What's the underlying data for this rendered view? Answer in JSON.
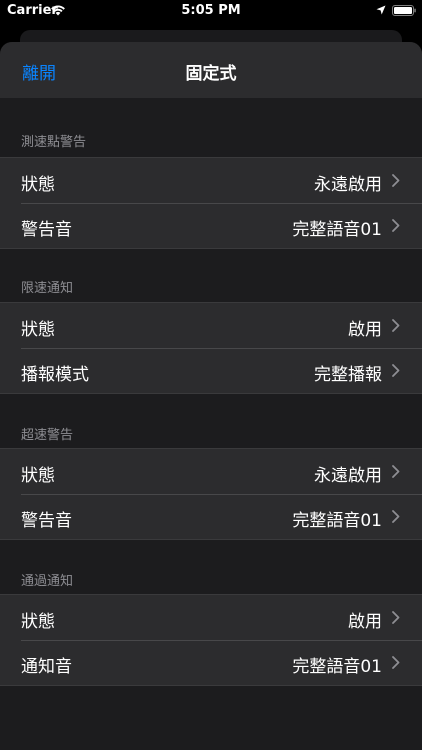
{
  "status_bar": {
    "carrier": "Carrier",
    "time": "5:05 PM",
    "wifi_icon": "wifi-icon",
    "location_icon": "location-arrow-icon",
    "battery_icon": "battery-full-icon"
  },
  "nav": {
    "close_label": "離開",
    "title": "固定式"
  },
  "colors": {
    "accent": "#0a84ff",
    "background": "#1c1c1e",
    "cell": "#2c2c2e",
    "secondary_text": "#8e8e93"
  },
  "sections": [
    {
      "header": "測速點警告",
      "rows": [
        {
          "label": "狀態",
          "value": "永遠啟用"
        },
        {
          "label": "警告音",
          "value": "完整語音01"
        }
      ]
    },
    {
      "header": "限速通知",
      "rows": [
        {
          "label": "狀態",
          "value": "啟用"
        },
        {
          "label": "播報模式",
          "value": "完整播報"
        }
      ]
    },
    {
      "header": "超速警告",
      "rows": [
        {
          "label": "狀態",
          "value": "永遠啟用"
        },
        {
          "label": "警告音",
          "value": "完整語音01"
        }
      ]
    },
    {
      "header": "通過通知",
      "rows": [
        {
          "label": "狀態",
          "value": "啟用"
        },
        {
          "label": "通知音",
          "value": "完整語音01"
        }
      ]
    }
  ]
}
